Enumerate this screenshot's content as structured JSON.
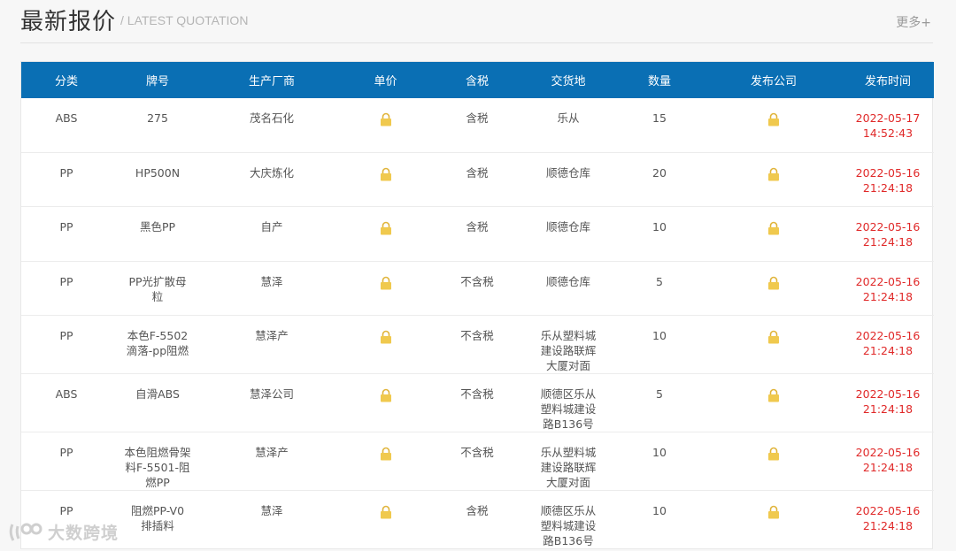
{
  "header": {
    "title": "最新报价",
    "subtitle": "/ LATEST QUOTATION",
    "more_label": "更多+"
  },
  "table": {
    "columns": [
      "分类",
      "牌号",
      "生产厂商",
      "单价",
      "含税",
      "交货地",
      "数量",
      "发布公司",
      "发布时间"
    ],
    "rows": [
      {
        "category": "ABS",
        "grade": "275",
        "maker": "茂名石化",
        "tax": "含税",
        "delivery": "乐从",
        "qty": "15",
        "date": "2022-05-17",
        "time": "14:52:43"
      },
      {
        "category": "PP",
        "grade": "HP500N",
        "maker": "大庆炼化",
        "tax": "含税",
        "delivery": "顺德仓库",
        "qty": "20",
        "date": "2022-05-16",
        "time": "21:24:18"
      },
      {
        "category": "PP",
        "grade": "黑色PP",
        "maker": "自产",
        "tax": "含税",
        "delivery": "顺德仓库",
        "qty": "10",
        "date": "2022-05-16",
        "time": "21:24:18"
      },
      {
        "category": "PP",
        "grade": "PP光扩散母粒",
        "maker": "慧泽",
        "tax": "不含税",
        "delivery": "顺德仓库",
        "qty": "5",
        "date": "2022-05-16",
        "time": "21:24:18"
      },
      {
        "category": "PP",
        "grade": "本色F-5502滴落-pp阻燃",
        "maker": "慧泽产",
        "tax": "不含税",
        "delivery": "乐从塑料城建设路联辉大厦对面",
        "qty": "10",
        "date": "2022-05-16",
        "time": "21:24:18"
      },
      {
        "category": "ABS",
        "grade": "自滑ABS",
        "maker": "慧泽公司",
        "tax": "不含税",
        "delivery": "顺德区乐从塑料城建设路B136号",
        "qty": "5",
        "date": "2022-05-16",
        "time": "21:24:18"
      },
      {
        "category": "PP",
        "grade": "本色阻燃骨架料F-5501-阻燃PP",
        "maker": "慧泽产",
        "tax": "不含税",
        "delivery": "乐从塑料城建设路联辉大厦对面",
        "qty": "10",
        "date": "2022-05-16",
        "time": "21:24:18"
      },
      {
        "category": "PP",
        "grade": "阻燃PP-V0 排插料",
        "maker": "慧泽",
        "tax": "含税",
        "delivery": "顺德区乐从塑料城建设路B136号",
        "qty": "10",
        "date": "2022-05-16",
        "time": "21:24:18"
      }
    ],
    "lock_icon": "lock-icon",
    "colors": {
      "header_bg": "#0a6fb4",
      "time_text": "#e02828",
      "lock": "#f0c94e"
    }
  },
  "watermark": {
    "text": "大数跨境"
  }
}
